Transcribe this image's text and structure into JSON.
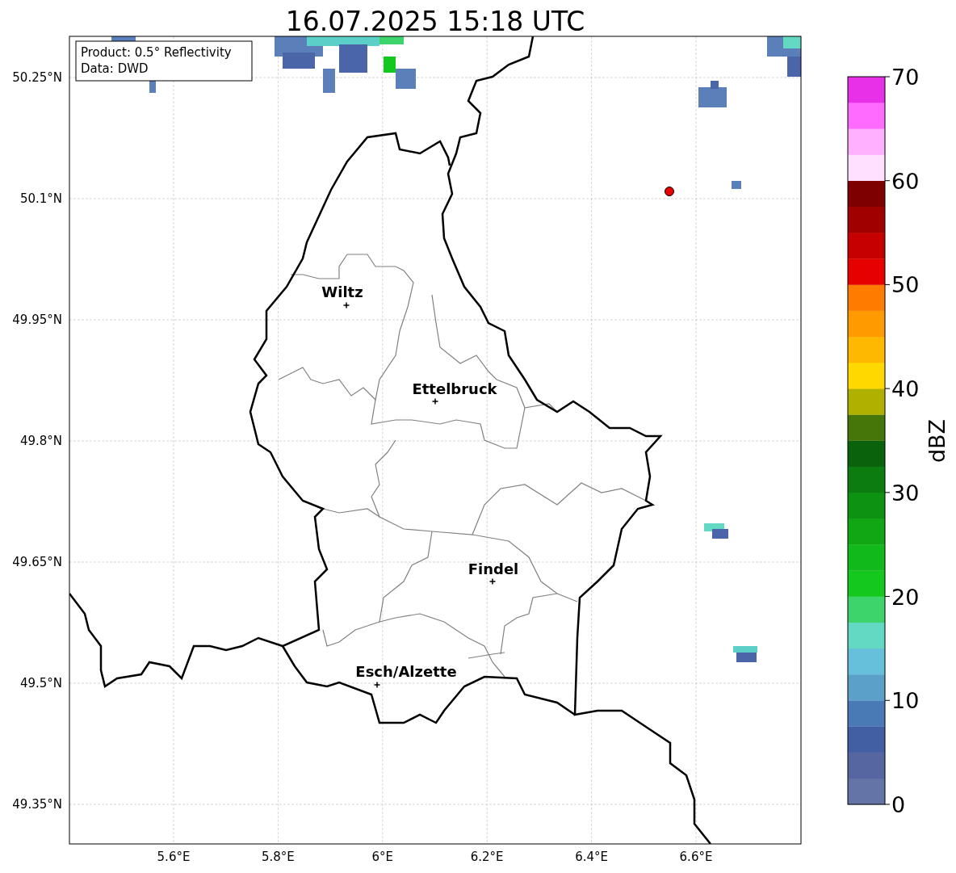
{
  "title": "16.07.2025 15:18 UTC",
  "info_box": {
    "lines": [
      "Product: 0.5° Reflectivity",
      "Data: DWD"
    ]
  },
  "map": {
    "yticks": [
      "50.25°N",
      "50.1°N",
      "49.95°N",
      "49.8°N",
      "49.65°N",
      "49.5°N",
      "49.35°N"
    ],
    "xticks": [
      "5.6°E",
      "5.8°E",
      "6°E",
      "6.2°E",
      "6.4°E",
      "6.6°E"
    ],
    "cities": [
      {
        "name": "Wiltz"
      },
      {
        "name": "Ettelbruck"
      },
      {
        "name": "Findel"
      },
      {
        "name": "Esch/Alzette"
      }
    ]
  },
  "colorbar": {
    "label": "dBZ",
    "ticks": [
      "70",
      "60",
      "50",
      "40",
      "30",
      "20",
      "10",
      "0"
    ],
    "bins": [
      {
        "color": "#6474a6"
      },
      {
        "color": "#5566a0"
      },
      {
        "color": "#435fa3"
      },
      {
        "color": "#4a7ab5"
      },
      {
        "color": "#5ba0c8"
      },
      {
        "color": "#66c0dc"
      },
      {
        "color": "#63d9c4"
      },
      {
        "color": "#3dd46c"
      },
      {
        "color": "#14c81e"
      },
      {
        "color": "#12b91a"
      },
      {
        "color": "#10a614"
      },
      {
        "color": "#0e9212"
      },
      {
        "color": "#0c7c10"
      },
      {
        "color": "#0a620c"
      },
      {
        "color": "#46760a"
      },
      {
        "color": "#b0b000"
      },
      {
        "color": "#ffd800"
      },
      {
        "color": "#ffb800"
      },
      {
        "color": "#ff9a00"
      },
      {
        "color": "#ff7c00"
      },
      {
        "color": "#e60000"
      },
      {
        "color": "#c60000"
      },
      {
        "color": "#a00000"
      },
      {
        "color": "#7e0000"
      },
      {
        "color": "#ffe0ff"
      },
      {
        "color": "#ffb0ff"
      },
      {
        "color": "#ff6aff"
      },
      {
        "color": "#e830e8"
      }
    ]
  }
}
